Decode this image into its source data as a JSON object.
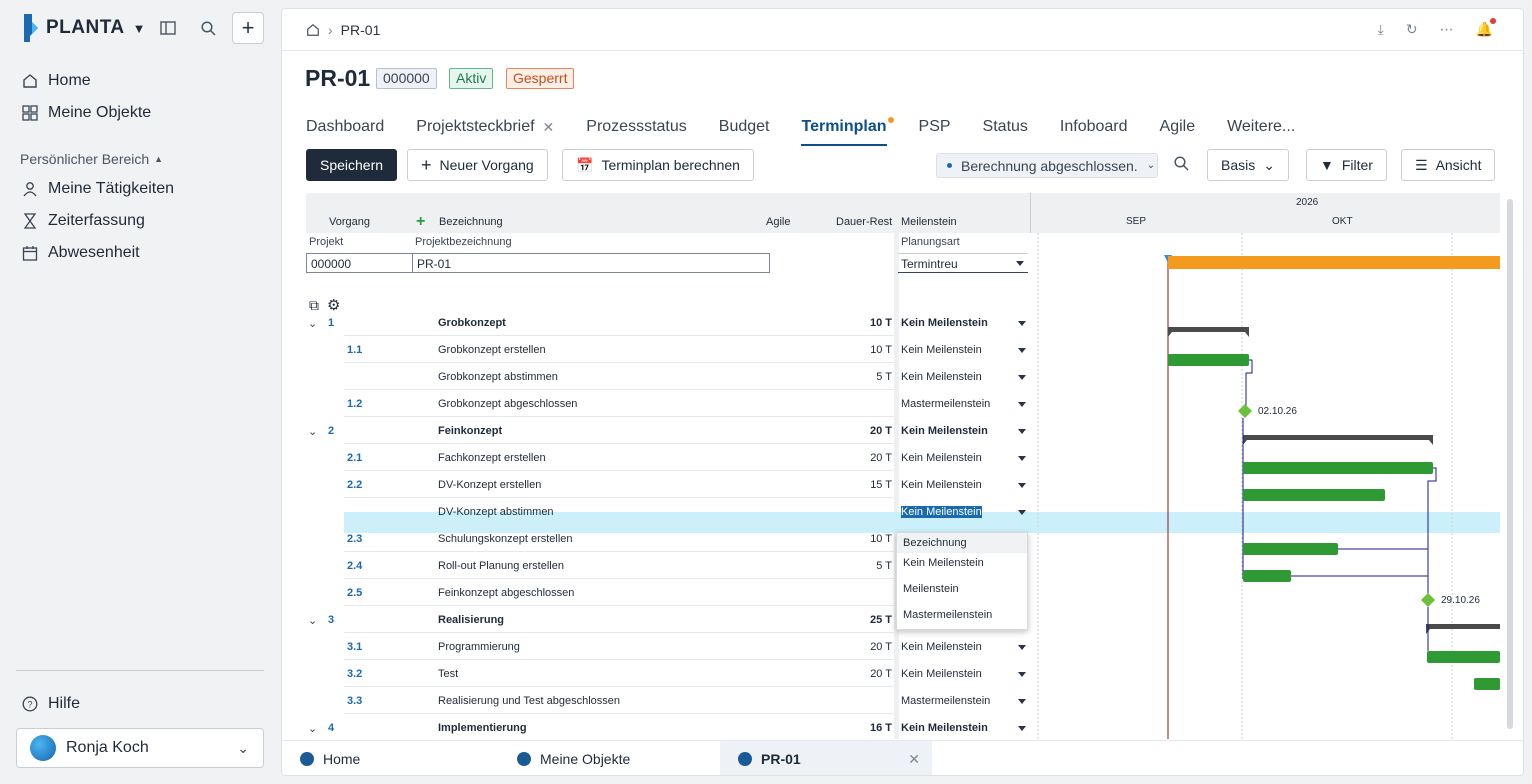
{
  "sidebar": {
    "brand": "PLANTA",
    "nav": [
      {
        "label": "Home",
        "icon": "home-icon"
      },
      {
        "label": "Meine Objekte",
        "icon": "grid-icon"
      }
    ],
    "section_label": "Persönlicher Bereich",
    "personal": [
      {
        "label": "Meine Tätigkeiten",
        "icon": "person-icon"
      },
      {
        "label": "Zeiterfassung",
        "icon": "hourglass-icon"
      },
      {
        "label": "Abwesenheit",
        "icon": "calendar-icon"
      }
    ],
    "help": "Hilfe",
    "user": "Ronja Koch"
  },
  "breadcrumb": {
    "current": "PR-01"
  },
  "header": {
    "title": "PR-01",
    "badges": [
      {
        "label": "000000",
        "color": "#eef1f5"
      },
      {
        "label": "Aktiv",
        "color": "#e6f6ef"
      },
      {
        "label": "Gesperrt",
        "color": "#fdeee6"
      }
    ]
  },
  "tabs": [
    "Dashboard",
    "Projektsteckbrief",
    "Prozessstatus",
    "Budget",
    "Terminplan",
    "PSP",
    "Status",
    "Infoboard",
    "Agile",
    "Weitere..."
  ],
  "active_tab": "Terminplan",
  "toolbar": {
    "save": "Speichern",
    "new_task": "Neuer Vorgang",
    "calc": "Terminplan berechnen",
    "status": "Berechnung abgeschlossen.",
    "basis": "Basis",
    "filter": "Filter",
    "view": "Ansicht"
  },
  "grid": {
    "headers": {
      "vorgang": "Vorgang",
      "bezeichnung": "Bezeichnung",
      "agile": "Agile",
      "dauer": "Dauer-Rest",
      "meilenstein": "Meilenstein",
      "year": "2026",
      "sep": "SEP",
      "okt": "OKT"
    },
    "project": {
      "projekt_label": "Projekt",
      "bez_label": "Projektbezeichnung",
      "planungsart_label": "Planungsart",
      "projekt_value": "000000",
      "bez_value": "PR-01",
      "planungsart_value": "Termintreu"
    },
    "rows": [
      {
        "id": "1",
        "name": "Grobkonzept",
        "dur": "10 T",
        "ms": "Kein Meilenstein",
        "bold": true
      },
      {
        "id": "1.1",
        "name": "Grobkonzept erstellen",
        "dur": "10 T",
        "ms": "Kein Meilenstein"
      },
      {
        "id": "",
        "name": "Grobkonzept abstimmen",
        "dur": "5 T",
        "ms": "Kein Meilenstein"
      },
      {
        "id": "1.2",
        "name": "Grobkonzept abgeschlossen",
        "dur": "",
        "ms": "Mastermeilenstein"
      },
      {
        "id": "2",
        "name": "Feinkonzept",
        "dur": "20 T",
        "ms": "Kein Meilenstein",
        "bold": true
      },
      {
        "id": "2.1",
        "name": "Fachkonzept erstellen",
        "dur": "20 T",
        "ms": "Kein Meilenstein"
      },
      {
        "id": "2.2",
        "name": "DV-Konzept erstellen",
        "dur": "15 T",
        "ms": "Kein Meilenstein"
      },
      {
        "id": "",
        "name": "DV-Konzept abstimmen",
        "dur": "",
        "ms": "Kein Meilenstein"
      },
      {
        "id": "2.3",
        "name": "Schulungskonzept erstellen",
        "dur": "10 T",
        "ms": ""
      },
      {
        "id": "2.4",
        "name": "Roll-out Planung erstellen",
        "dur": "5 T",
        "ms": ""
      },
      {
        "id": "2.5",
        "name": "Feinkonzept abgeschlossen",
        "dur": "",
        "ms": ""
      },
      {
        "id": "3",
        "name": "Realisierung",
        "dur": "25 T",
        "ms": "",
        "bold": true
      },
      {
        "id": "3.1",
        "name": "Programmierung",
        "dur": "20 T",
        "ms": "Kein Meilenstein"
      },
      {
        "id": "3.2",
        "name": "Test",
        "dur": "20 T",
        "ms": "Kein Meilenstein"
      },
      {
        "id": "3.3",
        "name": "Realisierung und Test abgeschlossen",
        "dur": "",
        "ms": "Mastermeilenstein"
      },
      {
        "id": "4",
        "name": "Implementierung",
        "dur": "16 T",
        "ms": "Kein Meilenstein",
        "bold": true
      }
    ],
    "dropdown": [
      "Bezeichnung",
      "Kein Meilenstein",
      "Meilenstein",
      "Mastermeilenstein"
    ],
    "milestones": [
      "02.10.26",
      "29.10.26"
    ]
  },
  "bottom_tabs": [
    "Home",
    "Meine Objekte",
    "PR-01"
  ]
}
